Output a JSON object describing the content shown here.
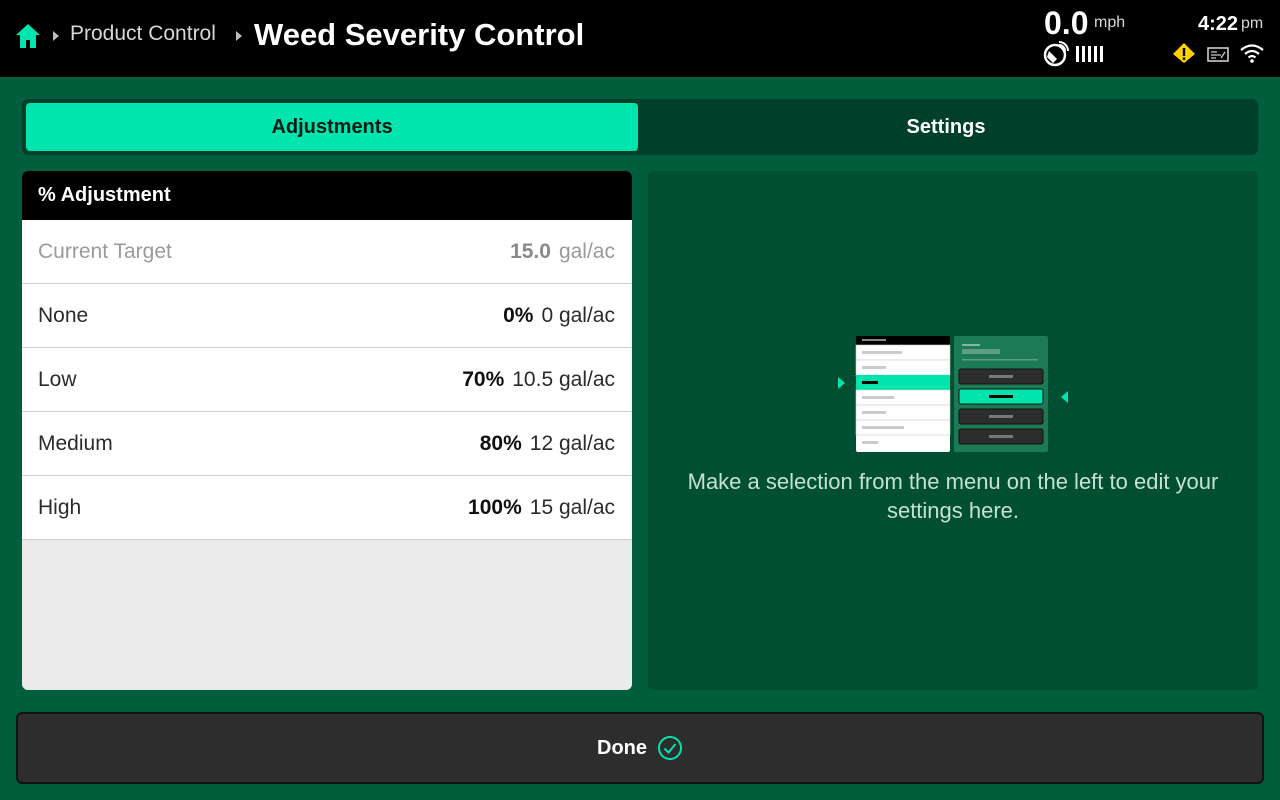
{
  "header": {
    "breadcrumb": {
      "parent": "Product Control",
      "current": "Weed Severity Control"
    },
    "speed": {
      "value": "0.0",
      "unit": "mph"
    },
    "clock": {
      "time": "4:22",
      "ampm": "pm"
    },
    "icons": [
      "home-icon",
      "gps-icon",
      "signal-bars-icon",
      "warning-icon",
      "terminal-icon",
      "wifi-icon"
    ]
  },
  "tabs": [
    {
      "label": "Adjustments",
      "active": true
    },
    {
      "label": "Settings",
      "active": false
    }
  ],
  "adjustment_panel": {
    "title": "% Adjustment",
    "current_target": {
      "label": "Current Target",
      "value": "15.0",
      "unit": "gal/ac"
    },
    "rows": [
      {
        "label": "None",
        "percent": "0%",
        "rate": "0 gal/ac"
      },
      {
        "label": "Low",
        "percent": "70%",
        "rate": "10.5 gal/ac"
      },
      {
        "label": "Medium",
        "percent": "80%",
        "rate": "12 gal/ac"
      },
      {
        "label": "High",
        "percent": "100%",
        "rate": "15 gal/ac"
      }
    ]
  },
  "info_panel": {
    "hint": "Make a selection from the menu on the left to edit your settings here."
  },
  "footer": {
    "done_label": "Done"
  },
  "colors": {
    "background": "#005e3d",
    "accent": "#00e5ae",
    "header": "#000000",
    "warning": "#ffd200"
  }
}
